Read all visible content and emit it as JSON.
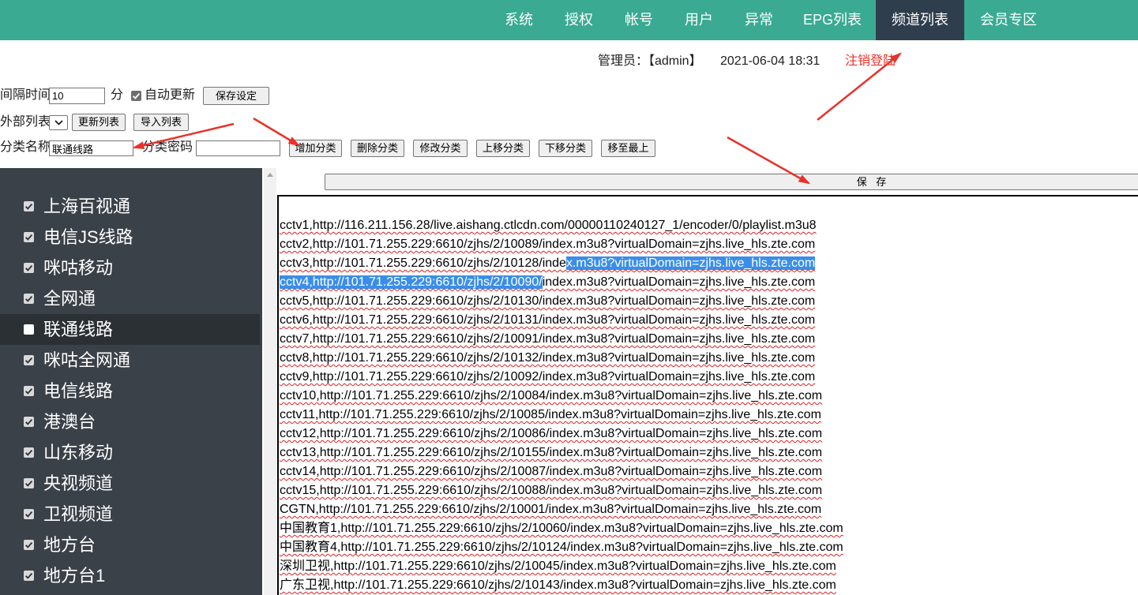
{
  "nav": {
    "items": [
      {
        "label": "系统"
      },
      {
        "label": "授权"
      },
      {
        "label": "帐号"
      },
      {
        "label": "用户"
      },
      {
        "label": "异常"
      },
      {
        "label": "EPG列表"
      },
      {
        "label": "频道列表",
        "active": true
      },
      {
        "label": "会员专区"
      }
    ]
  },
  "userbar": {
    "admin": "管理员：【admin】",
    "datetime": "2021-06-04 18:31",
    "logout": "注销登陆"
  },
  "settings": {
    "interval_label": "间隔时间",
    "interval_value": "10",
    "interval_unit": "分",
    "auto_update_label": "自动更新",
    "auto_update_checked": true,
    "save_settings": "保存设定"
  },
  "external": {
    "label": "外部列表",
    "update_list": "更新列表",
    "import_list": "导入列表"
  },
  "category": {
    "name_label": "分类名称",
    "name_value": "联通线路",
    "password_label": "分类密码",
    "buttons": {
      "add": "增加分类",
      "delete": "删除分类",
      "modify": "修改分类",
      "move_up": "上移分类",
      "move_down": "下移分类",
      "move_top": "移至最上"
    }
  },
  "sidebar": {
    "items": [
      {
        "label": "上海百视通",
        "checked": true
      },
      {
        "label": "电信JS线路",
        "checked": true
      },
      {
        "label": "咪咕移动",
        "checked": true
      },
      {
        "label": "全网通",
        "checked": true
      },
      {
        "label": "联通线路",
        "checked": false,
        "active": true
      },
      {
        "label": "咪咕全网通",
        "checked": true
      },
      {
        "label": "电信线路",
        "checked": true
      },
      {
        "label": "港澳台",
        "checked": true
      },
      {
        "label": "山东移动",
        "checked": true
      },
      {
        "label": "央视频道",
        "checked": true
      },
      {
        "label": "卫视频道",
        "checked": true
      },
      {
        "label": "地方台",
        "checked": true
      },
      {
        "label": "地方台1",
        "checked": true
      }
    ]
  },
  "editor": {
    "save_label": "保 存",
    "lines": [
      {
        "parts": [
          "cctv1,http://116.211.156.28/live.aishang.ctlcdn.com/00000110240127_1/encoder/0/playlist.m3u8"
        ]
      },
      {
        "parts": [
          "cctv2,http://101.71.255.229:6610/zjhs/2/10089/index.m3u8?virtualDomain=zjhs.live_hls.zte.com"
        ]
      },
      {
        "parts": [
          "cctv3,http://101.71.255.229:6610/zjhs/2/10128/inde",
          "x.m3u8?virtualDomain=zjhs.live_hls.zte.com"
        ],
        "selected": [
          false,
          true
        ]
      },
      {
        "parts": [
          "cctv4,http://101.71.255.229:6610/zjhs/2/10090/",
          "index.m3u8?virtualDomain=zjhs.live_hls.zte.com"
        ],
        "selected": [
          true,
          false
        ]
      },
      {
        "parts": [
          "cctv5,http://101.71.255.229:6610/zjhs/2/10130/index.m3u8?virtualDomain=zjhs.live_hls.zte.com"
        ]
      },
      {
        "parts": [
          "cctv6,http://101.71.255.229:6610/zjhs/2/10131/index.m3u8?virtualDomain=zjhs.live_hls.zte.com"
        ]
      },
      {
        "parts": [
          "cctv7,http://101.71.255.229:6610/zjhs/2/10091/index.m3u8?virtualDomain=zjhs.live_hls.zte.com"
        ]
      },
      {
        "parts": [
          "cctv8,http://101.71.255.229:6610/zjhs/2/10132/index.m3u8?virtualDomain=zjhs.live_hls.zte.com"
        ]
      },
      {
        "parts": [
          "cctv9,http://101.71.255.229:6610/zjhs/2/10092/index.m3u8?virtualDomain=zjhs.live_hls.zte.com"
        ]
      },
      {
        "parts": [
          "cctv10,http://101.71.255.229:6610/zjhs/2/10084/index.m3u8?virtualDomain=zjhs.live_hls.zte.com"
        ]
      },
      {
        "parts": [
          "cctv11,http://101.71.255.229:6610/zjhs/2/10085/index.m3u8?virtualDomain=zjhs.live_hls.zte.com"
        ]
      },
      {
        "parts": [
          "cctv12,http://101.71.255.229:6610/zjhs/2/10086/index.m3u8?virtualDomain=zjhs.live_hls.zte.com"
        ]
      },
      {
        "parts": [
          "cctv13,http://101.71.255.229:6610/zjhs/2/10155/index.m3u8?virtualDomain=zjhs.live_hls.zte.com"
        ]
      },
      {
        "parts": [
          "cctv14,http://101.71.255.229:6610/zjhs/2/10087/index.m3u8?virtualDomain=zjhs.live_hls.zte.com"
        ]
      },
      {
        "parts": [
          "cctv15,http://101.71.255.229:6610/zjhs/2/10088/index.m3u8?virtualDomain=zjhs.live_hls.zte.com"
        ]
      },
      {
        "parts": [
          "CGTN,http://101.71.255.229:6610/zjhs/2/10001/index.m3u8?virtualDomain=zjhs.live_hls.zte.com"
        ]
      },
      {
        "parts": [
          "中国教育1,http://101.71.255.229:6610/zjhs/2/10060/index.m3u8?virtualDomain=zjhs.live_hls.zte.com"
        ]
      },
      {
        "parts": [
          "中国教育4,http://101.71.255.229:6610/zjhs/2/10124/index.m3u8?virtualDomain=zjhs.live_hls.zte.com"
        ]
      },
      {
        "parts": [
          "深圳卫视,http://101.71.255.229:6610/zjhs/2/10045/index.m3u8?virtualDomain=zjhs.live_hls.zte.com"
        ]
      },
      {
        "parts": [
          "广东卫视,http://101.71.255.229:6610/zjhs/2/10143/index.m3u8?virtualDomain=zjhs.live_hls.zte.com"
        ]
      }
    ]
  },
  "colors": {
    "nav_bg": "#3aaa92",
    "nav_active_bg": "#2f3e4d",
    "sidebar_bg": "#3b4148",
    "sidebar_active_bg": "#2b3035",
    "logout": "#e8322a",
    "selection": "#3a8ee8",
    "annotation": "#e8322a"
  }
}
